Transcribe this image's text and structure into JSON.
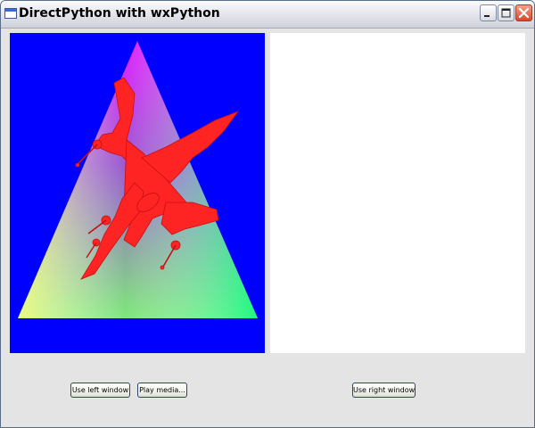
{
  "window": {
    "title": "DirectPython with wxPython",
    "icon": "app-window-icon",
    "controls": [
      "minimize-icon",
      "maximize-icon",
      "close-icon"
    ]
  },
  "left_view": {
    "background": "#0000ff",
    "scene": [
      "gradient-triangle",
      "red-spaceship-model"
    ]
  },
  "right_view": {
    "background": "#ffffff"
  },
  "buttons": {
    "use_left": "Use left window",
    "play_media": "Play media...",
    "use_right": "Use right window"
  },
  "colors": {
    "panel_bg": "#e4e4e4",
    "model_red": "#ff2020"
  }
}
